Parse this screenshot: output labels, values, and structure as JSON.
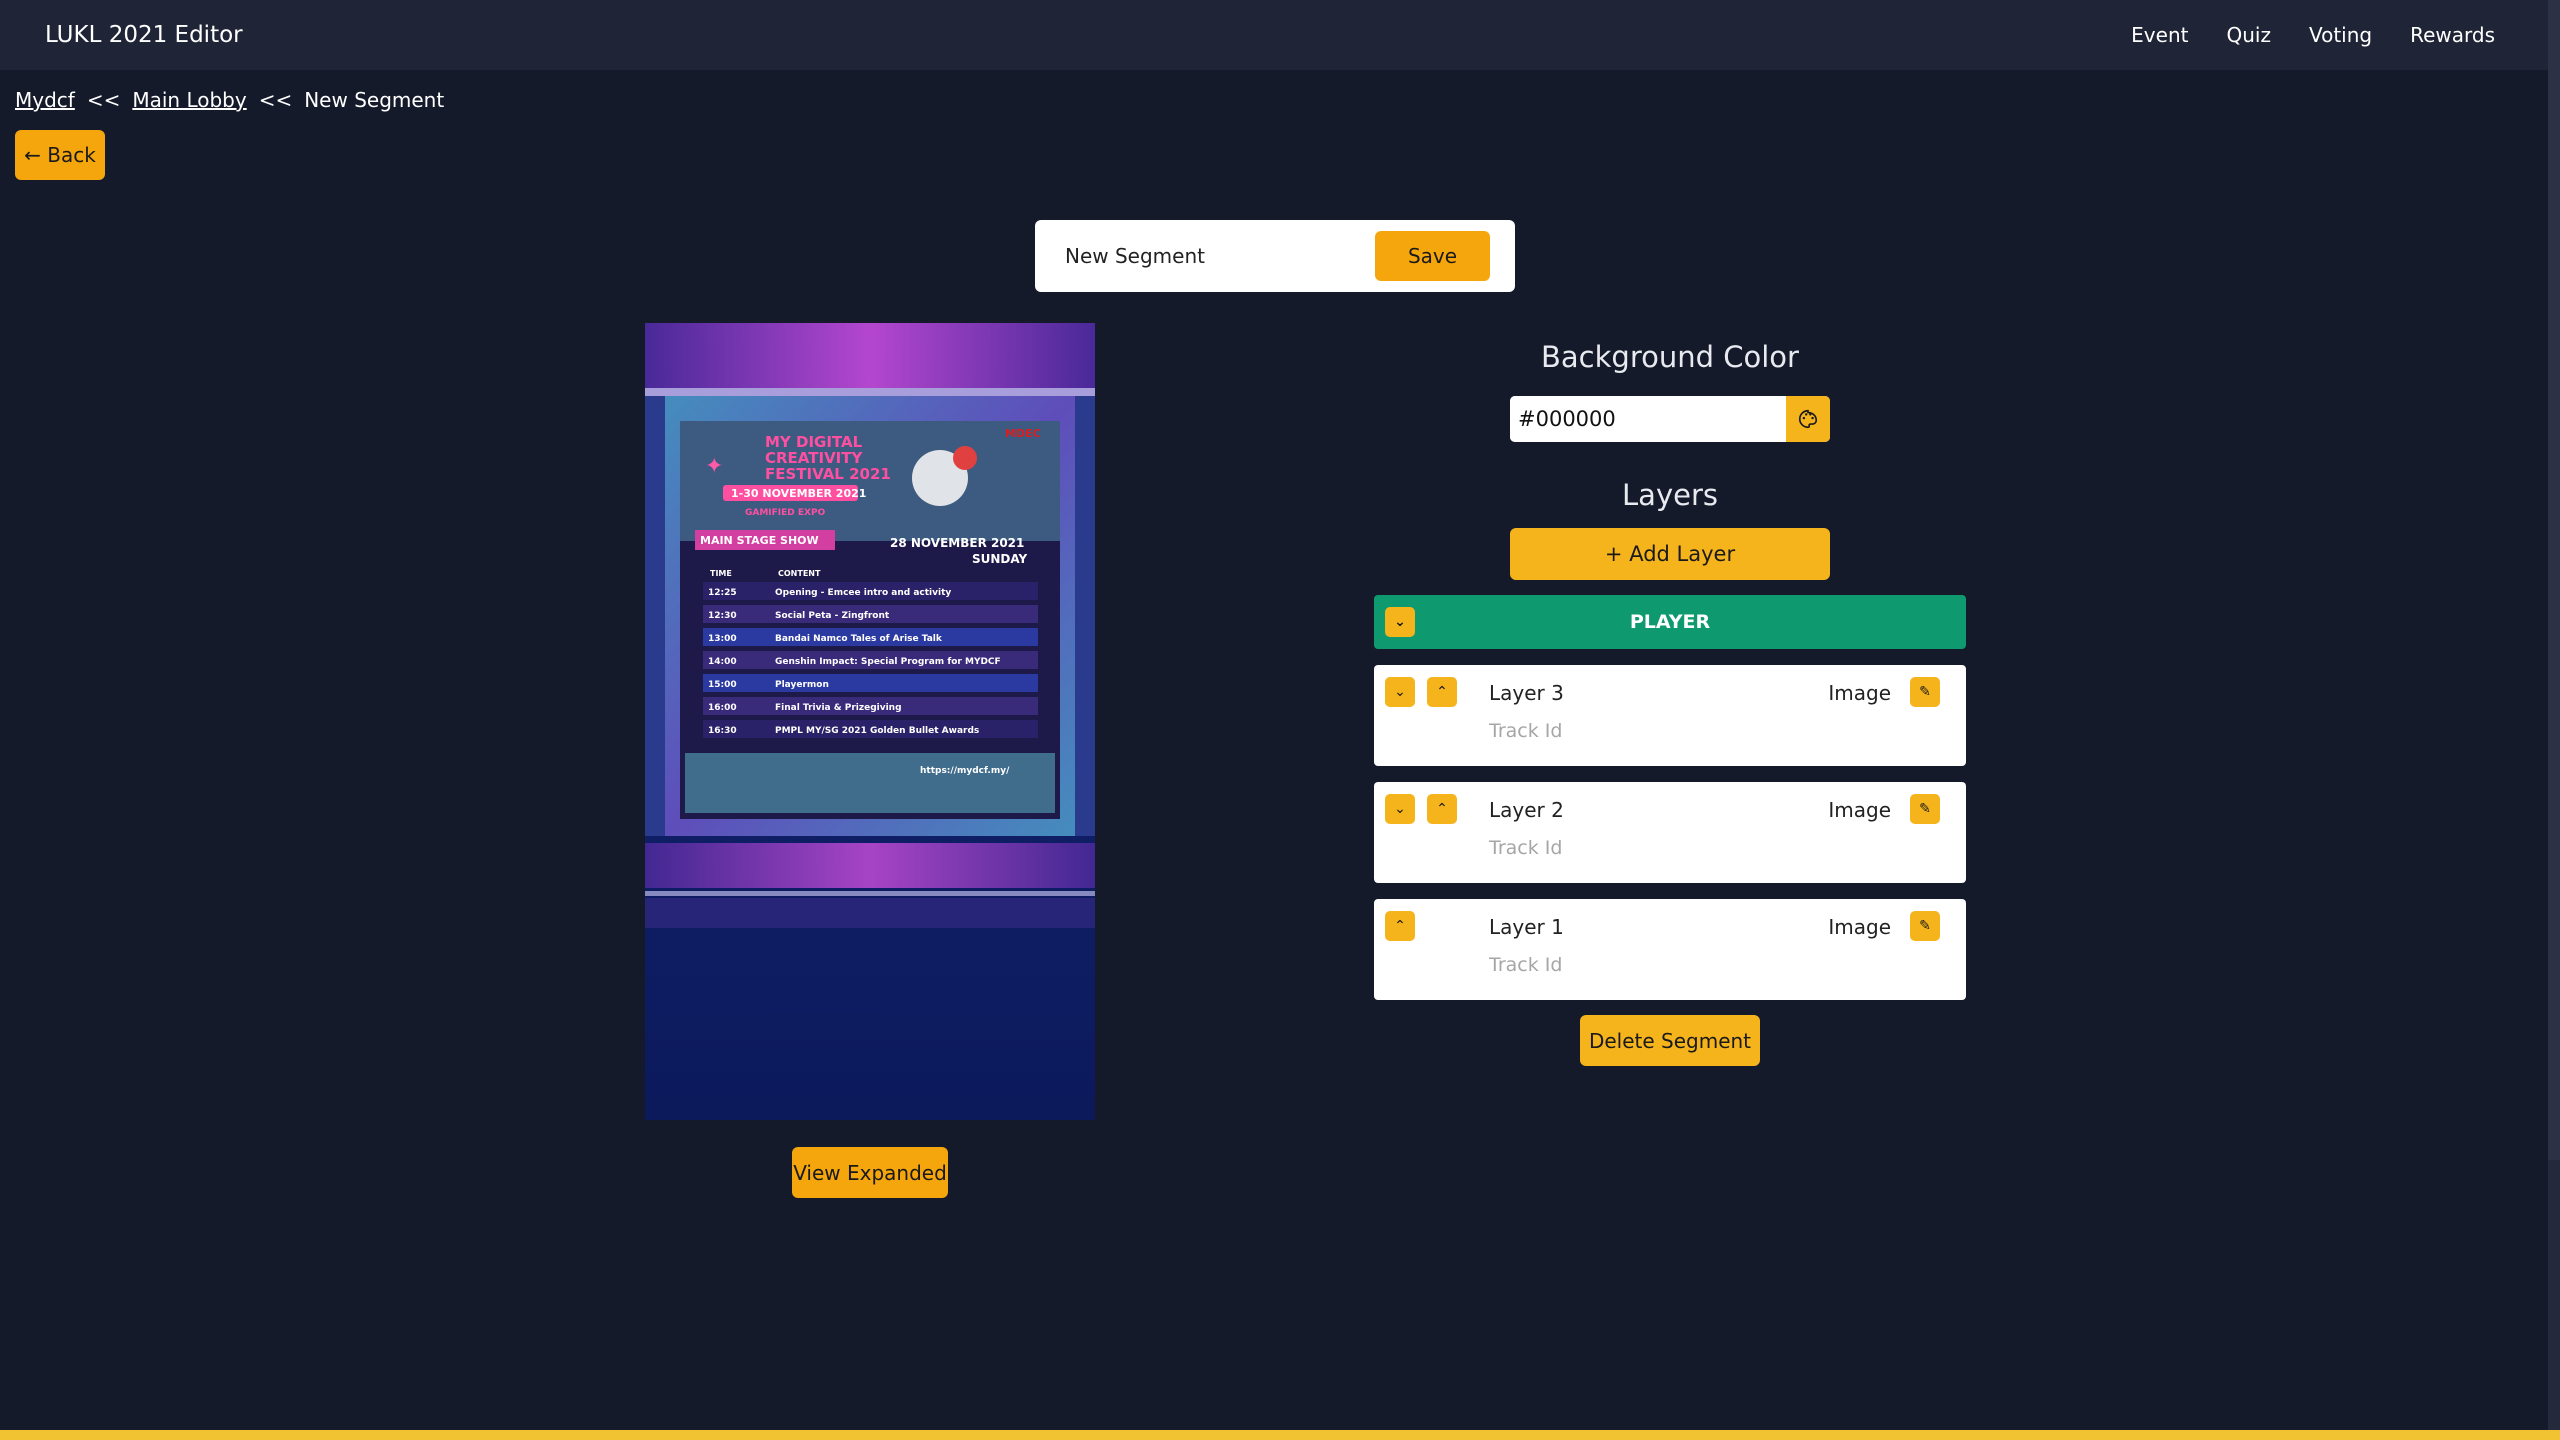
{
  "app": {
    "title": "LUKL 2021 Editor"
  },
  "nav": [
    "Event",
    "Quiz",
    "Voting",
    "Rewards"
  ],
  "breadcrumb": {
    "item1": "Mydcf",
    "sep": "<<",
    "item2": "Main Lobby",
    "current": "New Segment"
  },
  "back_button": "← Back",
  "segment": {
    "name": "New Segment",
    "save_label": "Save"
  },
  "preview": {
    "view_expanded_label": "View Expanded",
    "poster": {
      "title_line1": "MY DIGITAL",
      "title_line2": "CREATIVITY",
      "title_line3": "FESTIVAL 2021",
      "dates": "1-30 NOVEMBER 2021",
      "subtitle": "GAMIFIED EXPO",
      "logo": "MDEC",
      "stage": "MAIN STAGE SHOW",
      "date": "28 NOVEMBER 2021",
      "day": "SUNDAY",
      "col_time": "TIME",
      "col_content": "CONTENT",
      "schedule": [
        {
          "time": "12:25",
          "content": "Opening - Emcee intro and activity"
        },
        {
          "time": "12:30",
          "content": "Social Peta - Zingfront"
        },
        {
          "time": "13:00",
          "content": "Bandai Namco Tales of Arise Talk"
        },
        {
          "time": "14:00",
          "content": "Genshin Impact: Special Program for MYDCF"
        },
        {
          "time": "15:00",
          "content": "Playermon"
        },
        {
          "time": "16:00",
          "content": "Final Trivia & Prizegiving"
        },
        {
          "time": "16:30",
          "content": "PMPL MY/SG 2021 Golden Bullet Awards"
        }
      ],
      "url": "https://mydcf.my/"
    }
  },
  "background": {
    "title": "Background Color",
    "value": "#000000",
    "picker_icon": "palette-icon"
  },
  "layers": {
    "title": "Layers",
    "add_label": "+ Add Layer",
    "group": "PLAYER",
    "items": [
      {
        "name": "Layer 3",
        "track": "Track Id",
        "type": "Image"
      },
      {
        "name": "Layer 2",
        "track": "Track Id",
        "type": "Image"
      },
      {
        "name": "Layer 1",
        "track": "Track Id",
        "type": "Image"
      }
    ]
  },
  "delete_label": "Delete Segment",
  "colors": {
    "accent": "#f5b31c",
    "player": "#0e9a6e",
    "background": "#151a2b",
    "topbar": "#1f2536"
  }
}
